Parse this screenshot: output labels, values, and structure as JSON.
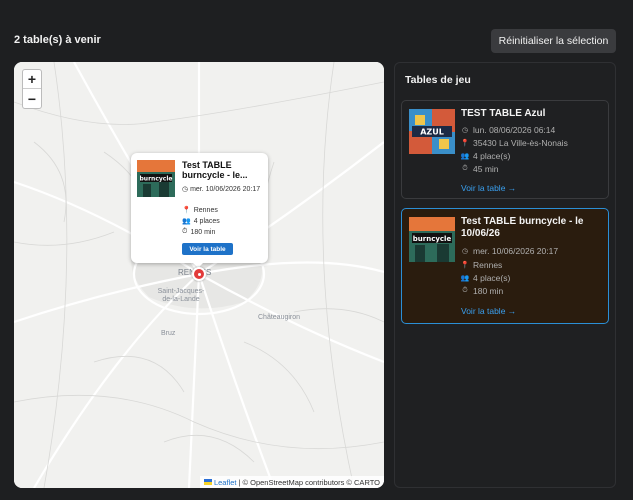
{
  "header": {
    "title": "2 table(s) à venir",
    "reset_label": "Réinitialiser la sélection"
  },
  "map": {
    "zoom_in": "+",
    "zoom_out": "−",
    "labels": {
      "rennes": "RENNES",
      "saint_jacques": "Saint-Jacques-de-la-Lande",
      "bruz": "Bruz",
      "chateaugiron": "Châteaugiron"
    },
    "popup": {
      "title": "Test TABLE burncycle - le...",
      "date": "mer. 10/06/2026 20:17",
      "location": "Rennes",
      "places": "4 places",
      "duration": "180 min",
      "button": "Voir la table"
    },
    "attribution": {
      "leaflet": "Leaflet",
      "text": "| © OpenStreetMap contributors © CARTO"
    }
  },
  "panel": {
    "title": "Tables de jeu",
    "cards": [
      {
        "title": "TEST TABLE Azul",
        "date": "lun. 08/06/2026 06:14",
        "location": "35430 La Ville-ès-Nonais",
        "places": "4 place(s)",
        "duration": "45 min",
        "link": "Voir la table →",
        "thumb_label": "AZUL"
      },
      {
        "title": "Test TABLE burncycle - le 10/06/26",
        "date": "mer. 10/06/2026 20:17",
        "location": "Rennes",
        "places": "4 place(s)",
        "duration": "180 min",
        "link": "Voir la table →",
        "thumb_label": "burncycle"
      }
    ]
  },
  "colors": {
    "accent_blue": "#2b8fd6",
    "marker_red": "#e23b3b",
    "background": "#1e1f21"
  }
}
